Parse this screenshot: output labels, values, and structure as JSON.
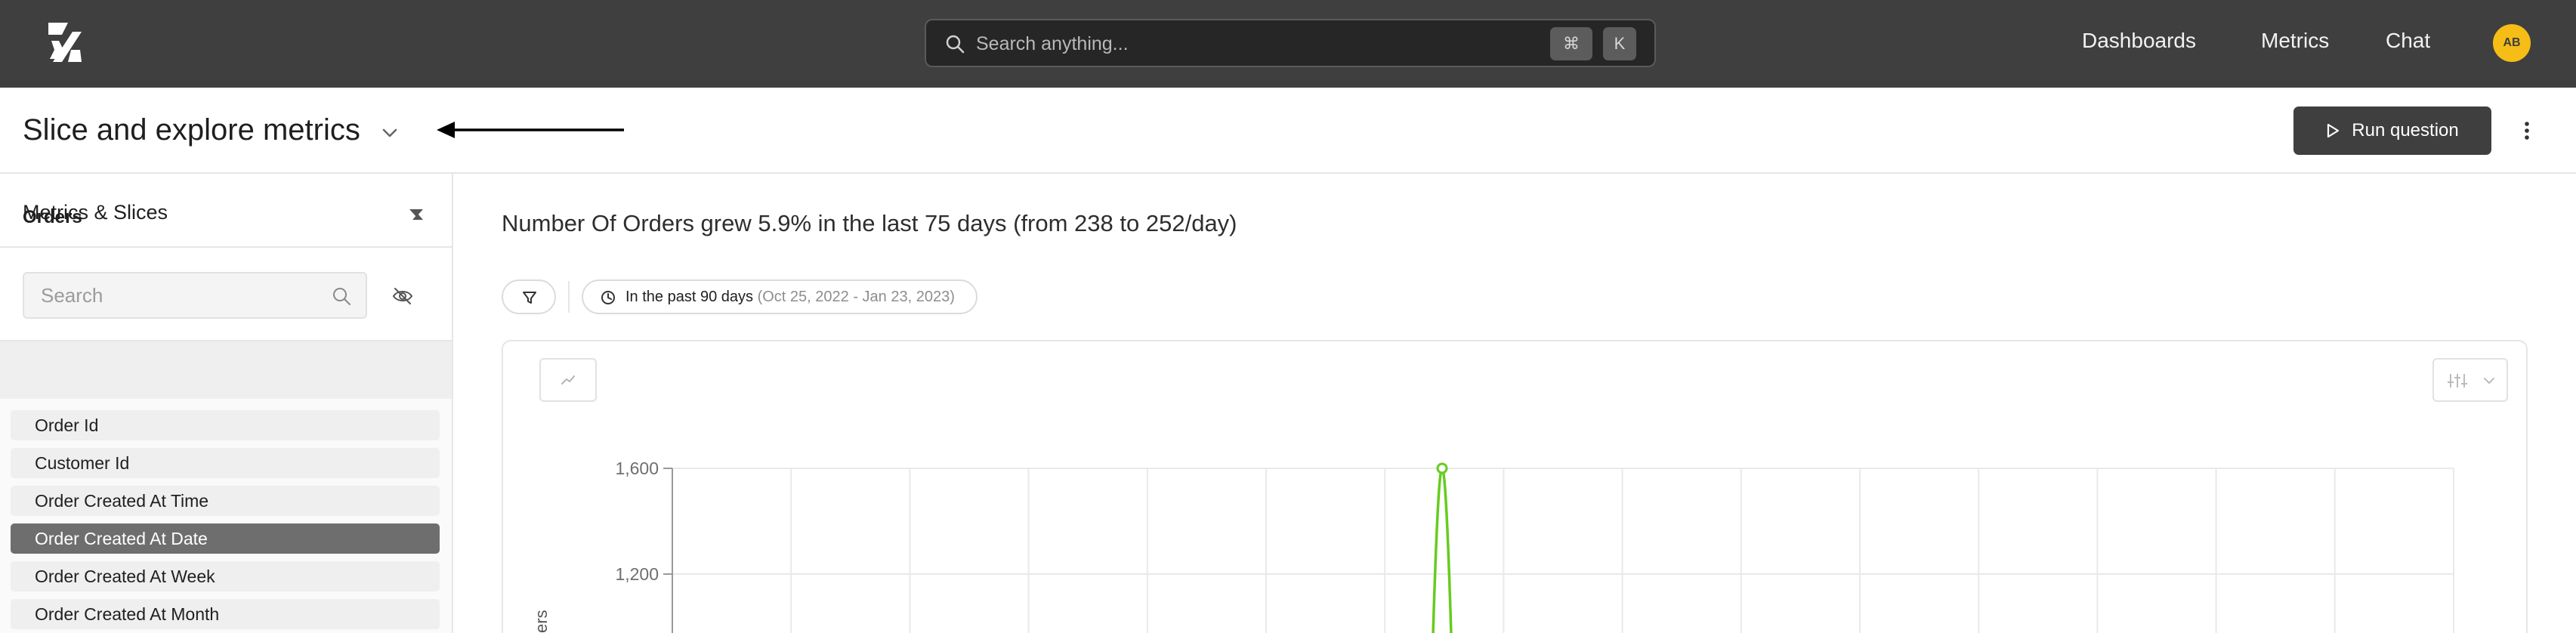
{
  "header": {
    "search": {
      "placeholder": "Search anything...",
      "shortcut_cmd": "⌘",
      "shortcut_key": "K"
    },
    "nav": [
      {
        "label": "Dashboards"
      },
      {
        "label": "Metrics"
      },
      {
        "label": "Chat"
      }
    ],
    "avatar_initials": "AB",
    "colors": {
      "bar_bg": "#3f3f3f",
      "avatar_bg": "#f5bd16"
    }
  },
  "title_bar": {
    "title": "Slice and explore metrics",
    "run_button_label": "Run question"
  },
  "sidebar": {
    "section_title": "Metrics & Slices",
    "search_placeholder": "Search",
    "group": {
      "title": "Orders",
      "items": [
        {
          "label": "Order Id",
          "selected": false
        },
        {
          "label": "Customer Id",
          "selected": false
        },
        {
          "label": "Order Created At Time",
          "selected": false
        },
        {
          "label": "Order Created At Date",
          "selected": true
        },
        {
          "label": "Order Created At Week",
          "selected": false
        },
        {
          "label": "Order Created At Month",
          "selected": false
        }
      ]
    }
  },
  "main": {
    "headline": "Number Of Orders grew 5.9% in the last 75 days (from 238 to 252/day)",
    "date_filter": {
      "label": "In the past 90 days",
      "range": "(Oct 25, 2022 - Jan 23, 2023)"
    }
  },
  "chart_data": {
    "type": "line",
    "y_ticks": [
      1200,
      1600
    ],
    "y_tick_labels": [
      "1,200",
      "1,600"
    ],
    "ylabel": "ers",
    "series": [
      {
        "color": "#66cc1e",
        "values": [
          null,
          1600,
          null
        ]
      }
    ],
    "peak_value": 1600,
    "grid": true,
    "colors": {
      "line": "#66cc1e",
      "grid": "#e9e9e9"
    }
  }
}
